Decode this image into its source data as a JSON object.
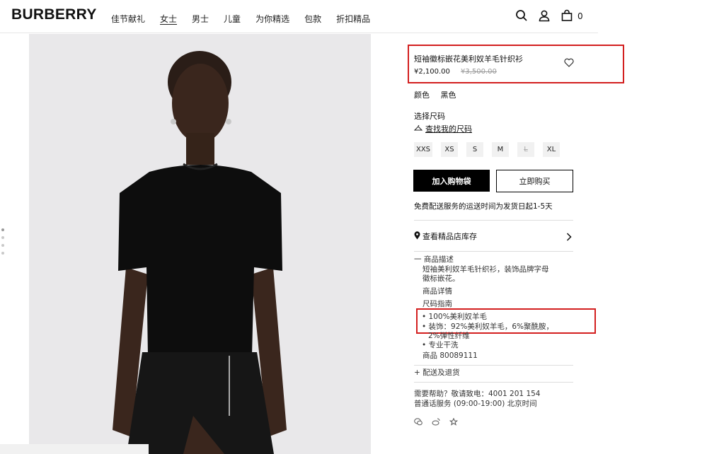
{
  "header": {
    "logo": "BURBERRY",
    "nav": [
      "佳节献礼",
      "女士",
      "男士",
      "儿童",
      "为你精选",
      "包款",
      "折扣精品"
    ],
    "active_nav": "女士",
    "bag_count": "0"
  },
  "product": {
    "title": "短袖徽标嵌花美利奴羊毛针织衫",
    "price": "¥2,100.00",
    "original_price": "¥3,500.00",
    "color_label": "颜色",
    "color_value": "黑色",
    "size_title": "选择尺码",
    "size_guide": "查找我的尺码",
    "sizes": [
      {
        "label": "XXS",
        "available": true
      },
      {
        "label": "XS",
        "available": true
      },
      {
        "label": "S",
        "available": true
      },
      {
        "label": "M",
        "available": true
      },
      {
        "label": "L",
        "available": false
      },
      {
        "label": "XL",
        "available": true
      }
    ],
    "add_to_bag": "加入购物袋",
    "buy_now": "立即购买",
    "shipping_note": "免费配送服务的运送时间为发货日起1-5天",
    "store_stock": "查看精品店库存"
  },
  "description": {
    "section_title": "一 商品描述",
    "summary_line1": "短袖美利奴羊毛针织衫，装饰品牌字母",
    "summary_line2": "徽标嵌花。",
    "details_title": "商品详情",
    "size_guide_title": "尺码指南",
    "bullet1": "• 100%美利奴羊毛",
    "bullet2": "• 装饰：92%美利奴羊毛，6%聚酰胺，",
    "bullet2_cont": "2%弹性纤维",
    "bullet3": "• 专业干洗",
    "item_number": "商品 80089111"
  },
  "delivery": {
    "title": "+ 配送及退货"
  },
  "help": {
    "line1": "需要帮助？敬请致电：4001 201 154",
    "line2": "普通话服务 (09:00-19:00) 北京时间"
  },
  "colors": {
    "highlight": "#d31f1f",
    "button_dark": "#000000",
    "size_bg": "#f1f1f1"
  }
}
